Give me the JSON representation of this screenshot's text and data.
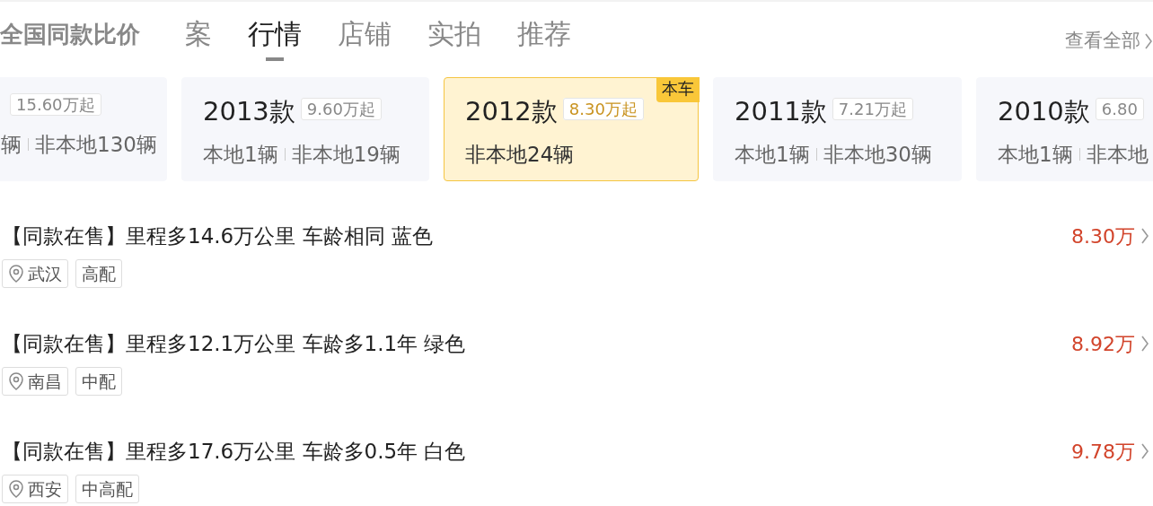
{
  "heading": "全国同款比价",
  "tabs": [
    {
      "label": "案",
      "selected": false
    },
    {
      "label": "行情",
      "selected": true
    },
    {
      "label": "店铺",
      "selected": false
    },
    {
      "label": "实拍",
      "selected": false
    },
    {
      "label": "推荐",
      "selected": false
    }
  ],
  "view_all": "查看全部",
  "versions": [
    {
      "price": "15.60万起",
      "local": "辆",
      "remote": "非本地130辆",
      "selected": false
    },
    {
      "year": "2013款",
      "price": "9.60万起",
      "local": "本地1辆",
      "remote": "非本地19辆",
      "selected": false
    },
    {
      "year": "2012款",
      "price": "8.30万起",
      "remote": "非本地24辆",
      "selected": true,
      "badge": "本车"
    },
    {
      "year": "2011款",
      "price": "7.21万起",
      "local": "本地1辆",
      "remote": "非本地30辆",
      "selected": false
    },
    {
      "year": "2010款",
      "price": "6.80",
      "local": "本地1辆",
      "remote": "非本地",
      "selected": false
    }
  ],
  "listings": [
    {
      "title": "【同款在售】里程多14.6万公里 车龄相同 蓝色",
      "price": "8.30万",
      "city": "武汉",
      "trim": "高配"
    },
    {
      "title": "【同款在售】里程多12.1万公里 车龄多1.1年 绿色",
      "price": "8.92万",
      "city": "南昌",
      "trim": "中配"
    },
    {
      "title": "【同款在售】里程多17.6万公里 车龄多0.5年 白色",
      "price": "9.78万",
      "city": "西安",
      "trim": "中高配"
    }
  ]
}
